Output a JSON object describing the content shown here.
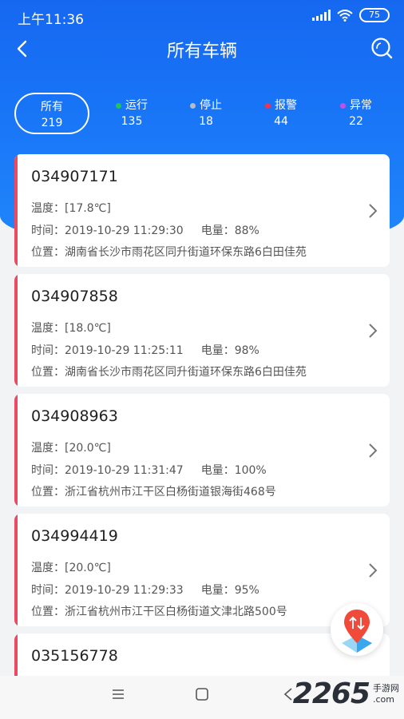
{
  "status": {
    "time": "上午11:36",
    "battery": "75"
  },
  "header": {
    "title": "所有车辆"
  },
  "tabs": [
    {
      "label": "所有",
      "count": "219",
      "dot_color": ""
    },
    {
      "label": "运行",
      "count": "135",
      "dot_color": "#21c45a"
    },
    {
      "label": "停止",
      "count": "18",
      "dot_color": "#b6bcc6"
    },
    {
      "label": "报警",
      "count": "44",
      "dot_color": "#f0344f"
    },
    {
      "label": "异常",
      "count": "22",
      "dot_color": "#c44fe0"
    }
  ],
  "labels": {
    "temp": "温度：",
    "time": "时间：",
    "battery": "电量：",
    "location": "位置："
  },
  "vehicles": [
    {
      "id": "034907171",
      "temp": "[17.8℃]",
      "time": "2019-10-29 11:29:30",
      "battery": "88%",
      "location": "湖南省长沙市雨花区同升街道环保东路6白田佳苑"
    },
    {
      "id": "034907858",
      "temp": "[18.0℃]",
      "time": "2019-10-29 11:25:11",
      "battery": "98%",
      "location": "湖南省长沙市雨花区同升街道环保东路6白田佳苑"
    },
    {
      "id": "034908963",
      "temp": "[20.0℃]",
      "time": "2019-10-29 11:31:47",
      "battery": "100%",
      "location": "浙江省杭州市江干区白杨街道银海街468号"
    },
    {
      "id": "034994419",
      "temp": "[20.0℃]",
      "time": "2019-10-29 11:29:33",
      "battery": "95%",
      "location": "浙江省杭州市江干区白杨街道文津北路500号"
    },
    {
      "id": "035156778"
    }
  ],
  "watermark": {
    "number": "2265",
    "name": "手游网",
    "domain": ".com"
  },
  "colors": {
    "accent": "#1873f6",
    "alarm_bar": "#ec4a63"
  }
}
